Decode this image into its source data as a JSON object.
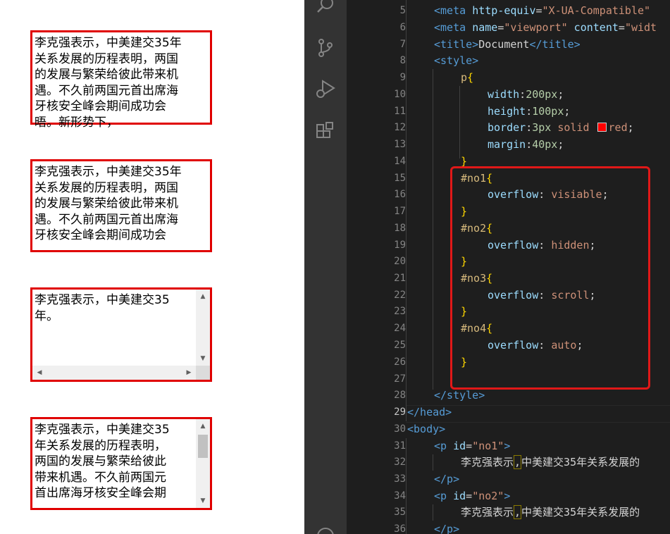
{
  "preview": {
    "demo_text": "李克强表示，中美建交35年关系发展的历程表明，两国的发展与繁荣给彼此带来机遇。不久前两国元首出席海牙核安全峰会期间成功会晤。新形势下，",
    "no1_lines": [
      "李克强表示，中美建交35年",
      "关系发展的历程表明，两国",
      "的发展与繁荣给彼此带来机",
      "遇。不久前两国元首出席海",
      "牙核安全峰会期间成功会",
      "晤。新形势下，"
    ],
    "no2_lines": [
      "李克强表示，中美建交35年",
      "关系发展的历程表明，两国",
      "的发展与繁荣给彼此带来机",
      "遇。不久前两国元首出席海",
      "牙核安全峰会期间成功会"
    ],
    "no3_lines": [
      "李克强表示，中美建交35",
      "年。"
    ],
    "no4_lines": [
      "李克强表示，中美建交35",
      "年关系发展的历程表明，",
      "两国的发展与繁荣给彼此",
      "带来机遇。不久前两国元",
      "首出席海牙核安全峰会期"
    ],
    "scroll_up_glyph": "▲",
    "scroll_down_glyph": "▼",
    "scroll_left_glyph": "◀",
    "scroll_right_glyph": "▶"
  },
  "editor": {
    "line_numbers": [
      "5",
      "6",
      "7",
      "8",
      "9",
      "10",
      "11",
      "12",
      "13",
      "14",
      "15",
      "16",
      "17",
      "18",
      "19",
      "20",
      "21",
      "22",
      "23",
      "24",
      "25",
      "26",
      "27",
      "28",
      "29",
      "30",
      "31",
      "32",
      "33",
      "34",
      "35",
      "36"
    ],
    "current_line": "29",
    "code": {
      "l5_a": "<meta ",
      "l5_b": "http-equiv",
      "l5_c": "=",
      "l5_d": "\"X-UA-Compatible\"",
      "l6_a": "<meta ",
      "l6_b": "name",
      "l6_c": "=",
      "l6_d": "\"viewport\"",
      "l6_e": " content",
      "l6_f": "=",
      "l6_g": "\"widt",
      "l7_a": "<title>",
      "l7_b": "Document",
      "l7_c": "</title>",
      "l8": "<style>",
      "l9_a": "p",
      "l9_b": "{",
      "l10_a": "width",
      "l10_b": ":",
      "l10_c": "200px",
      "l10_d": ";",
      "l11_a": "height",
      "l11_b": ":",
      "l11_c": "100px",
      "l11_d": ";",
      "l12_a": "border",
      "l12_b": ":",
      "l12_c": "3px",
      "l12_d": " solid ",
      "l12_e": "red",
      "l12_f": ";",
      "l13_a": "margin",
      "l13_b": ":",
      "l13_c": "40px",
      "l13_d": ";",
      "l14": "}",
      "l15_a": "#no1",
      "l15_b": "{",
      "l16_a": "overflow",
      "l16_b": ": ",
      "l16_c": "visiable",
      "l16_d": ";",
      "l17": "}",
      "l18_a": "#no2",
      "l18_b": "{",
      "l19_a": "overflow",
      "l19_b": ": ",
      "l19_c": "hidden",
      "l19_d": ";",
      "l20": "}",
      "l21_a": "#no3",
      "l21_b": "{",
      "l22_a": "overflow",
      "l22_b": ": ",
      "l22_c": "scroll",
      "l22_d": ";",
      "l23": "}",
      "l24_a": "#no4",
      "l24_b": "{",
      "l25_a": "overflow",
      "l25_b": ": ",
      "l25_c": "auto",
      "l25_d": ";",
      "l26": "}",
      "l28": "</style>",
      "l29": "</head>",
      "l30": "<body>",
      "l31_a": "<p ",
      "l31_b": "id",
      "l31_c": "=",
      "l31_d": "\"no1\"",
      "l31_e": ">",
      "l32_a": "李克强表示",
      "l32_b": ",",
      "l32_c": "中美建交35年关系发展的",
      "l33": "</p>",
      "l34_a": "<p ",
      "l34_b": "id",
      "l34_c": "=",
      "l34_d": "\"no2\"",
      "l34_e": ">",
      "l35_a": "李克强表示",
      "l35_b": ",",
      "l35_c": "中美建交35年关系发展的",
      "l36": "</p>"
    },
    "colors": {
      "tag": "#569cd6",
      "attr": "#9cdcfe",
      "string": "#ce9178",
      "selector": "#d7ba7d",
      "number": "#b5cea8",
      "highlight_border": "#e01818",
      "swatch_red": "#ff0000"
    },
    "icons": [
      "search-icon",
      "source-control-icon",
      "run-debug-icon",
      "extensions-icon",
      "account-icon"
    ]
  }
}
